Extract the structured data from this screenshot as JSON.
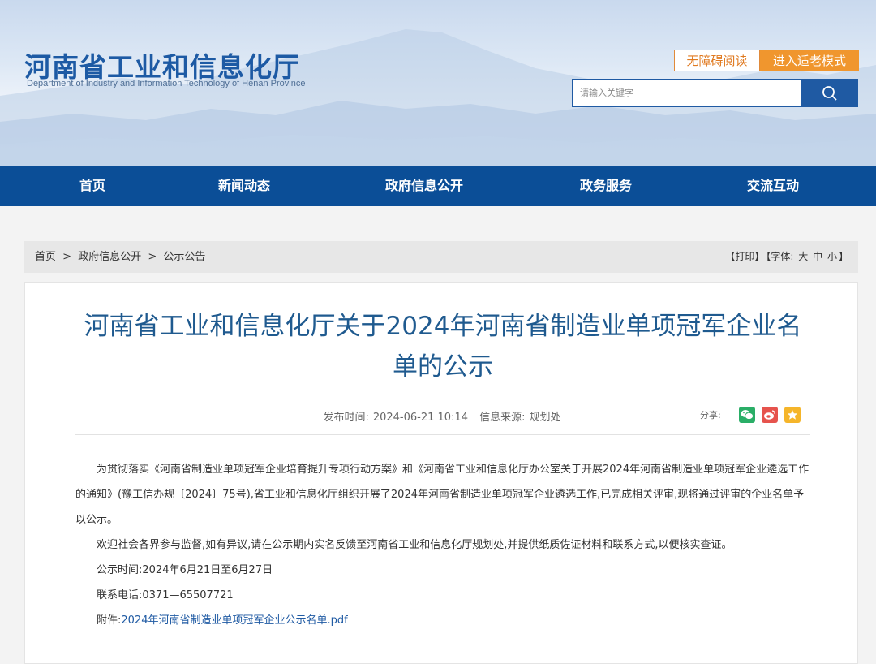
{
  "header": {
    "title": "河南省工业和信息化厅",
    "subtitle": "Department of Industry and Information Technology of Henan Province",
    "accessibility_label": "无障碍阅读",
    "elder_mode_label": "进入适老模式",
    "search_placeholder": "请输入关键字"
  },
  "nav": {
    "items": [
      "首页",
      "新闻动态",
      "政府信息公开",
      "政务服务",
      "交流互动"
    ]
  },
  "breadcrumb": {
    "items": [
      "首页",
      ">",
      "政府信息公开",
      ">",
      "公示公告"
    ]
  },
  "tools": {
    "print": "【打印】",
    "font_label": "【字体:",
    "size_large": "大",
    "size_medium": "中",
    "size_small": "小",
    "close_bracket": "】"
  },
  "article": {
    "title": "河南省工业和信息化厅关于2024年河南省制造业单项冠军企业名单的公示",
    "publish_label": "发布时间:",
    "publish_time": "2024-06-21 10:14",
    "source_label": "信息来源:",
    "source": "规划处",
    "share_label": "分享:",
    "para1": "为贯彻落实《河南省制造业单项冠军企业培育提升专项行动方案》和《河南省工业和信息化厅办公室关于开展2024年河南省制造业单项冠军企业遴选工作的通知》(豫工信办规〔2024〕75号),省工业和信息化厅组织开展了2024年河南省制造业单项冠军企业遴选工作,已完成相关评审,现将通过评审的企业名单予以公示。",
    "para2": "欢迎社会各界参与监督,如有异议,请在公示期内实名反馈至河南省工业和信息化厅规划处,并提供纸质佐证材料和联系方式,以便核实查证。",
    "period": "公示时间:2024年6月21日至6月27日",
    "phone": "联系电话:0371—65507721",
    "attachment_label": "附件:",
    "attachment_link": "2024年河南省制造业单项冠军企业公示名单.pdf"
  },
  "colors": {
    "brand_blue": "#0b4e97",
    "title_blue": "#1f5a8f",
    "accent_orange": "#f0962e",
    "wechat_green": "#2aae67",
    "weibo_red": "#e6534d",
    "favorite_yellow": "#f5b52a"
  },
  "icons": [
    "search-icon",
    "wechat-icon",
    "weibo-icon",
    "favorite-icon"
  ]
}
